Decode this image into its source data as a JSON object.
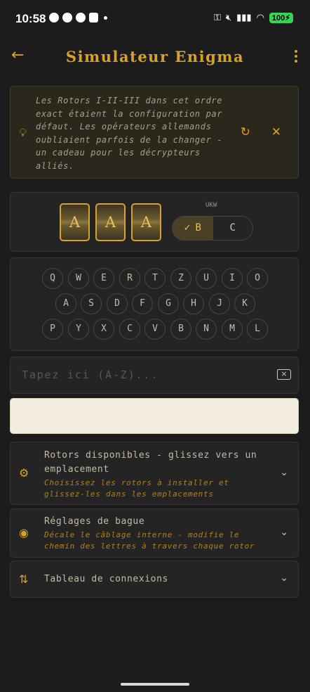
{
  "status_bar": {
    "time": "10:58",
    "battery": "100",
    "left_icons": [
      "chat-bubble-icon",
      "whatsapp-icon",
      "github-icon",
      "calendar-icon",
      "dot-icon"
    ],
    "right_icons": [
      "key-icon",
      "mute-icon",
      "signal-icon",
      "wifi-icon",
      "battery-icon"
    ]
  },
  "app_bar": {
    "title": "Simulateur Enigma",
    "back_icon": "arrow-left-icon",
    "menu_icon": "more-vertical-icon"
  },
  "info_tip": {
    "text": "Les Rotors I-II-III dans cet ordre exact étaient la configuration par défaut. Les opérateurs allemands oubliaient parfois de la changer - un cadeau pour les décrypteurs alliés.",
    "icons": [
      "lightbulb-icon",
      "refresh-icon",
      "close-icon"
    ]
  },
  "rotors": {
    "positions": [
      "A",
      "A",
      "A"
    ],
    "ukw_label": "UKW",
    "ukw_options": [
      "B",
      "C"
    ],
    "ukw_selected": "B"
  },
  "keyboard": {
    "rows": [
      [
        "Q",
        "W",
        "E",
        "R",
        "T",
        "Z",
        "U",
        "I",
        "O"
      ],
      [
        "A",
        "S",
        "D",
        "F",
        "G",
        "H",
        "J",
        "K"
      ],
      [
        "P",
        "Y",
        "X",
        "C",
        "V",
        "B",
        "N",
        "M",
        "L"
      ]
    ]
  },
  "input": {
    "placeholder": "Tapez ici (A-Z)...",
    "value": "",
    "backspace_icon": "backspace-icon"
  },
  "output": {
    "text": ""
  },
  "sections": [
    {
      "title": "Rotors disponibles - glissez vers un emplacement",
      "subtitle": "Choisissez les rotors à installer et glissez-les dans les emplacements",
      "icon": "gear-icon"
    },
    {
      "title": "Réglages de bague",
      "subtitle": "Décale le câblage interne - modifie le chemin des lettres à travers chaque rotor",
      "icon": "target-icon"
    },
    {
      "title": "Tableau de connexions",
      "subtitle": "",
      "icon": "plug-icon"
    }
  ],
  "colors": {
    "accent": "#d8a128",
    "background": "#1c1c1c",
    "output_bg": "#f2edde"
  }
}
